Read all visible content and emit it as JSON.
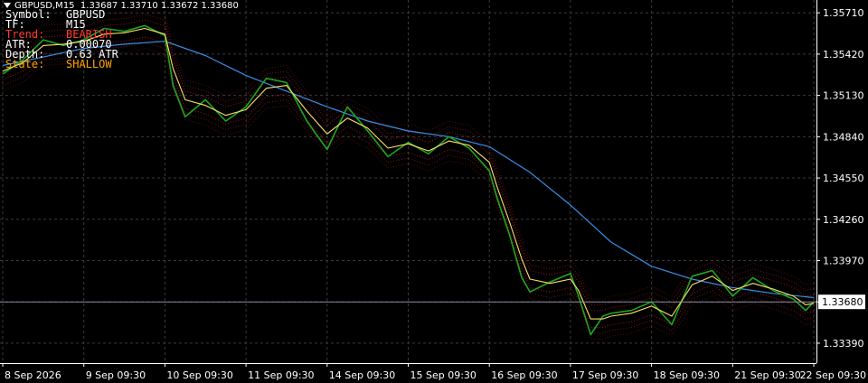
{
  "header": {
    "symbol_timeframe": "GBPUSD,M15",
    "ohlc": "1.33687 1.33710 1.33672 1.33680"
  },
  "info_panel": [
    {
      "key": "Symbol:",
      "value": "GBPUSD",
      "color": "#ffffff"
    },
    {
      "key": "TF:",
      "value": "M15",
      "color": "#ffffff"
    },
    {
      "key": "Trend:",
      "value": "BEARISH",
      "color": "#ff3b30"
    },
    {
      "key": "ATR:",
      "value": "0.00070",
      "color": "#ffffff"
    },
    {
      "key": "Depth:",
      "value": "0.63 ATR",
      "color": "#ffffff"
    },
    {
      "key": "State:",
      "value": "SHALLOW",
      "color": "#ffa500"
    }
  ],
  "colors": {
    "price": "#1fa51f",
    "fast_ma": "#ffe066",
    "slow_ma": "#3a8ee6",
    "band": "#b02020",
    "current_price_line": "#8a8aa0",
    "grid": "#3a3a3a"
  },
  "chart_data": {
    "type": "line",
    "ylim": [
      1.3325,
      1.358
    ],
    "y_ticks": [
      "1.35710",
      "1.35420",
      "1.35130",
      "1.34840",
      "1.34550",
      "1.34260",
      "1.33970",
      "1.33680",
      "1.33390"
    ],
    "y_tick_values": [
      1.3571,
      1.3542,
      1.3513,
      1.3484,
      1.3455,
      1.3426,
      1.3397,
      1.3368,
      1.3339
    ],
    "current_price_label": "1.33680",
    "current_price": 1.3368,
    "x_ticks": [
      "8 Sep 2026",
      "9 Sep 09:30",
      "10 Sep 09:30",
      "11 Sep 09:30",
      "14 Sep 09:30",
      "15 Sep 09:30",
      "16 Sep 09:30",
      "17 Sep 09:30",
      "18 Sep 09:30",
      "21 Sep 09:30",
      "22 Sep 09:30"
    ],
    "x_tick_index": [
      0,
      1,
      2,
      3,
      4,
      5,
      6,
      7,
      8,
      9,
      10
    ],
    "series": [
      {
        "key": "price",
        "x": [
          0,
          0.25,
          0.5,
          0.75,
          1.0,
          1.25,
          1.5,
          1.75,
          2.0,
          2.1,
          2.25,
          2.5,
          2.75,
          3.0,
          3.25,
          3.5,
          3.75,
          4.0,
          4.25,
          4.5,
          4.75,
          5.0,
          5.25,
          5.5,
          5.75,
          6.0,
          6.1,
          6.25,
          6.4,
          6.5,
          6.75,
          7.0,
          7.1,
          7.25,
          7.4,
          7.5,
          7.75,
          8.0,
          8.25,
          8.5,
          8.75,
          9.0,
          9.25,
          9.5,
          9.75,
          9.9,
          10.0
        ],
        "values": [
          1.3528,
          1.3538,
          1.3552,
          1.3548,
          1.3552,
          1.356,
          1.3558,
          1.3562,
          1.3555,
          1.352,
          1.3498,
          1.351,
          1.3495,
          1.3505,
          1.3525,
          1.3522,
          1.3495,
          1.3475,
          1.3505,
          1.3488,
          1.347,
          1.348,
          1.3472,
          1.3484,
          1.3476,
          1.346,
          1.344,
          1.3415,
          1.3385,
          1.3375,
          1.3382,
          1.3388,
          1.3372,
          1.3345,
          1.3358,
          1.336,
          1.3362,
          1.3368,
          1.3352,
          1.3386,
          1.339,
          1.3372,
          1.3385,
          1.3376,
          1.337,
          1.3362,
          1.3368
        ]
      },
      {
        "key": "fast_ma",
        "x": [
          0,
          0.25,
          0.5,
          0.75,
          1.0,
          1.25,
          1.5,
          1.75,
          2.0,
          2.1,
          2.25,
          2.5,
          2.75,
          3.0,
          3.25,
          3.5,
          3.75,
          4.0,
          4.25,
          4.5,
          4.75,
          5.0,
          5.25,
          5.5,
          5.75,
          6.0,
          6.1,
          6.25,
          6.4,
          6.5,
          6.75,
          7.0,
          7.1,
          7.25,
          7.4,
          7.5,
          7.75,
          8.0,
          8.25,
          8.5,
          8.75,
          9.0,
          9.25,
          9.5,
          9.75,
          9.9,
          10.0
        ],
        "values": [
          1.353,
          1.3536,
          1.3548,
          1.3549,
          1.3551,
          1.3556,
          1.3557,
          1.356,
          1.3556,
          1.3532,
          1.351,
          1.3506,
          1.3499,
          1.3503,
          1.3518,
          1.352,
          1.3502,
          1.3486,
          1.3497,
          1.349,
          1.3476,
          1.3479,
          1.3474,
          1.3481,
          1.3478,
          1.3466,
          1.3448,
          1.3424,
          1.3398,
          1.3384,
          1.3381,
          1.3384,
          1.3376,
          1.3356,
          1.3356,
          1.3358,
          1.336,
          1.3365,
          1.3358,
          1.338,
          1.3386,
          1.3376,
          1.3381,
          1.3377,
          1.3372,
          1.3366,
          1.3367
        ]
      },
      {
        "key": "slow_ma",
        "x": [
          0,
          0.5,
          1.0,
          1.5,
          2.0,
          2.5,
          3.0,
          3.5,
          4.0,
          4.5,
          5.0,
          5.5,
          6.0,
          6.5,
          7.0,
          7.5,
          8.0,
          8.5,
          9.0,
          9.5,
          10.0
        ],
        "values": [
          1.3534,
          1.354,
          1.3546,
          1.3549,
          1.3551,
          1.3541,
          1.3527,
          1.3516,
          1.3505,
          1.3495,
          1.3488,
          1.3484,
          1.3477,
          1.3459,
          1.3436,
          1.341,
          1.3393,
          1.3384,
          1.3378,
          1.3374,
          1.3371
        ]
      }
    ],
    "xlabel": "",
    "ylabel": "",
    "grid": true
  }
}
